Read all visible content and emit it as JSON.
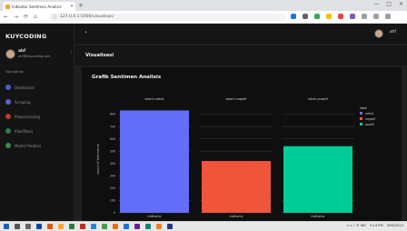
{
  "browser": {
    "tab_title": "Indikator Sentimen Analisis",
    "tab_close": "×",
    "new_tab": "+",
    "window_controls": [
      "—",
      "□",
      "×"
    ],
    "nav_buttons": [
      "←",
      "→",
      "⟳",
      "⌂"
    ],
    "url": "127.0.0.1:5000/visualisasi",
    "extension_colors": [
      "#1a73e8",
      "#5f6368",
      "#34a853",
      "#fbbc04",
      "#ea4335",
      "#7e57c2",
      "#9aa0a6",
      "#9aa0a6",
      "#9aa0a6"
    ]
  },
  "sidebar": {
    "brand": "KUYCODING",
    "user_name": "ahf",
    "user_email": "ahf@kuycoding.com",
    "section_label": "Navigation",
    "items": [
      {
        "label": "Dashboard",
        "color": "#4b5bd6"
      },
      {
        "label": "Scraping",
        "color": "#5b5fd8"
      },
      {
        "label": "Preprocessing",
        "color": "#c0392b"
      },
      {
        "label": "Klasifikasi",
        "color": "#2e7d4f"
      },
      {
        "label": "Model Prediksi",
        "color": "#2e8b57"
      }
    ]
  },
  "topbar": {
    "user": "ahf"
  },
  "page": {
    "title": "Visualisasi",
    "card_title": "Grafik Sentimen Analisis"
  },
  "chart_data": {
    "type": "bar",
    "facets": [
      "label=netral",
      "label=negatif",
      "label=positif"
    ],
    "categories": [
      "Indihome",
      "Indihome",
      "Indihome"
    ],
    "series": [
      {
        "name": "netral",
        "values": [
          830
        ],
        "color": "#636efa"
      },
      {
        "name": "negatif",
        "values": [
          420
        ],
        "color": "#ef553b"
      },
      {
        "name": "positif",
        "values": [
          540
        ],
        "color": "#00cc96"
      }
    ],
    "ylabel": "count of Username",
    "yticks": [
      0,
      100,
      200,
      300,
      400,
      500,
      600,
      700,
      800
    ],
    "ylim": [
      0,
      870
    ],
    "legend_title": "label",
    "legend": [
      "netral",
      "negatif",
      "positif"
    ],
    "grid": true,
    "legend_position": "right"
  },
  "taskbar": {
    "icon_colors": [
      "#1565c0",
      "#555",
      "#666",
      "#0d47a1",
      "#e65100",
      "#f9a825",
      "#2e7d32",
      "#c62828",
      "#1e88e5",
      "#43a047",
      "#ef6c00",
      "#1976d2",
      "#6a1b9a",
      "#00897b",
      "#f57f17",
      "#283593"
    ],
    "tray": "∧  ⌂  ♪  ⚟  IND",
    "time": "9:14 PM",
    "date": "9/06/2023"
  }
}
